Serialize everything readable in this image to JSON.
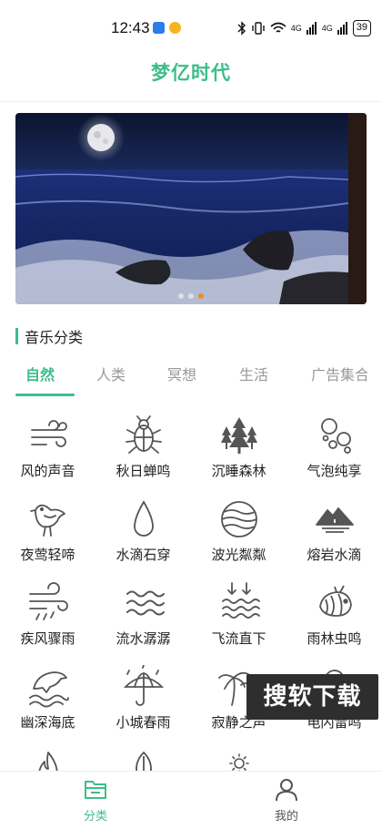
{
  "status_bar": {
    "time": "12:43",
    "signal_text_1": "4G",
    "signal_text_2": "4G",
    "battery": "39"
  },
  "app": {
    "title": "梦亿时代"
  },
  "banner": {
    "slide_count": 3,
    "active_index": 2
  },
  "section": {
    "title": "音乐分类"
  },
  "tabs": [
    {
      "label": "自然",
      "active": true
    },
    {
      "label": "人类",
      "active": false
    },
    {
      "label": "冥想",
      "active": false
    },
    {
      "label": "生活",
      "active": false
    },
    {
      "label": "广告集合",
      "active": false
    }
  ],
  "categories": [
    {
      "label": "风的声音",
      "icon": "wind-icon"
    },
    {
      "label": "秋日蝉鸣",
      "icon": "cicada-icon"
    },
    {
      "label": "沉睡森林",
      "icon": "forest-icon"
    },
    {
      "label": "气泡纯享",
      "icon": "bubbles-icon"
    },
    {
      "label": "夜莺轻啼",
      "icon": "bird-icon"
    },
    {
      "label": "水滴石穿",
      "icon": "water-drop-icon"
    },
    {
      "label": "波光粼粼",
      "icon": "water-sphere-icon"
    },
    {
      "label": "熔岩水滴",
      "icon": "lava-icon"
    },
    {
      "label": "疾风骤雨",
      "icon": "wind-rain-icon"
    },
    {
      "label": "流水潺潺",
      "icon": "waves-icon"
    },
    {
      "label": "飞流直下",
      "icon": "waterfall-icon"
    },
    {
      "label": "雨林虫鸣",
      "icon": "insect-icon"
    },
    {
      "label": "幽深海底",
      "icon": "dolphin-icon"
    },
    {
      "label": "小城春雨",
      "icon": "umbrella-icon"
    },
    {
      "label": "寂静之声",
      "icon": "palm-tree-icon"
    },
    {
      "label": "电闪雷鸣",
      "icon": "thunder-icon"
    },
    {
      "label": "",
      "icon": "fire-icon"
    },
    {
      "label": "",
      "icon": "leaf-icon"
    },
    {
      "label": "",
      "icon": "sun-icon"
    }
  ],
  "watermark": {
    "text": "搜软下载"
  },
  "bottom_nav": [
    {
      "label": "分类",
      "icon": "folder-icon",
      "active": true
    },
    {
      "label": "我的",
      "icon": "profile-icon",
      "active": false
    }
  ],
  "colors": {
    "accent": "#3dbd8b",
    "banner_dot_active": "#f08a2c",
    "icon_stroke": "#555555"
  }
}
